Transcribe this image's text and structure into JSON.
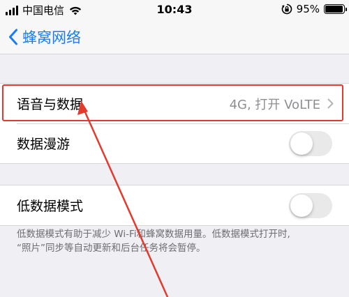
{
  "status_bar": {
    "carrier": "中国电信",
    "time": "10:43",
    "battery_text": "95%",
    "battery_level": 0.95,
    "icons": [
      "signal-icon",
      "wifi-icon",
      "orientation-lock-icon",
      "battery-icon"
    ]
  },
  "nav": {
    "back_label": "蜂窝网络",
    "back_icon": "chevron-left-icon"
  },
  "group1": {
    "voice_data": {
      "label": "语音与数据",
      "detail": "4G, 打开 VoLTE"
    },
    "data_roaming": {
      "label": "数据漫游",
      "toggle_on": false
    }
  },
  "group2": {
    "low_data_mode": {
      "label": "低数据模式",
      "toggle_on": false
    }
  },
  "footer": {
    "line1": "低数据模式有助于减少 Wi-Fi和蜂窝数据用量。低数据模式打开时,",
    "line2": "“照片”同步等自动更新和后台任务将会暂停。"
  },
  "colors": {
    "accent": "#1a7cf5",
    "annotation": "#e23a2d",
    "background": "#efeff4"
  }
}
